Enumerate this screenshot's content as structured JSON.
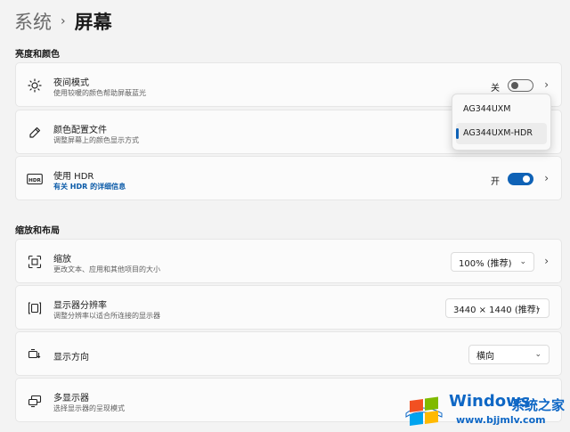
{
  "breadcrumb": {
    "root": "系统",
    "separator": "›",
    "current": "屏幕"
  },
  "section_brightness": "亮度和颜色",
  "night_mode": {
    "title": "夜间模式",
    "subtitle": "使用较暖的颜色帮助屏蔽蓝光",
    "state_label": "关",
    "enabled": false
  },
  "color_profile": {
    "title": "颜色配置文件",
    "subtitle": "调整屏幕上的颜色显示方式"
  },
  "profile_popup": {
    "options": [
      "AG344UXM",
      "AG344UXM-HDR"
    ],
    "selected": "AG344UXM-HDR"
  },
  "hdr": {
    "title": "使用 HDR",
    "link": "有关 HDR 的详细信息",
    "state_label": "开",
    "enabled": true
  },
  "section_scale": "缩放和布局",
  "scale": {
    "title": "缩放",
    "subtitle": "更改文本、应用和其他项目的大小",
    "value": "100% (推荐)"
  },
  "resolution": {
    "title": "显示器分辨率",
    "subtitle": "调整分辨率以适合所连接的显示器",
    "value": "3440 × 1440 (推荐)"
  },
  "orientation": {
    "title": "显示方向",
    "value": "横向"
  },
  "multi_display": {
    "title": "多显示器",
    "subtitle": "选择显示器的呈现模式"
  },
  "watermark": {
    "brand": "Windows",
    "brand_cn": "系统之家",
    "url": "www.bjjmlv.com"
  },
  "colors": {
    "accent": "#0f62b6",
    "watermark": "#0e67c5"
  }
}
